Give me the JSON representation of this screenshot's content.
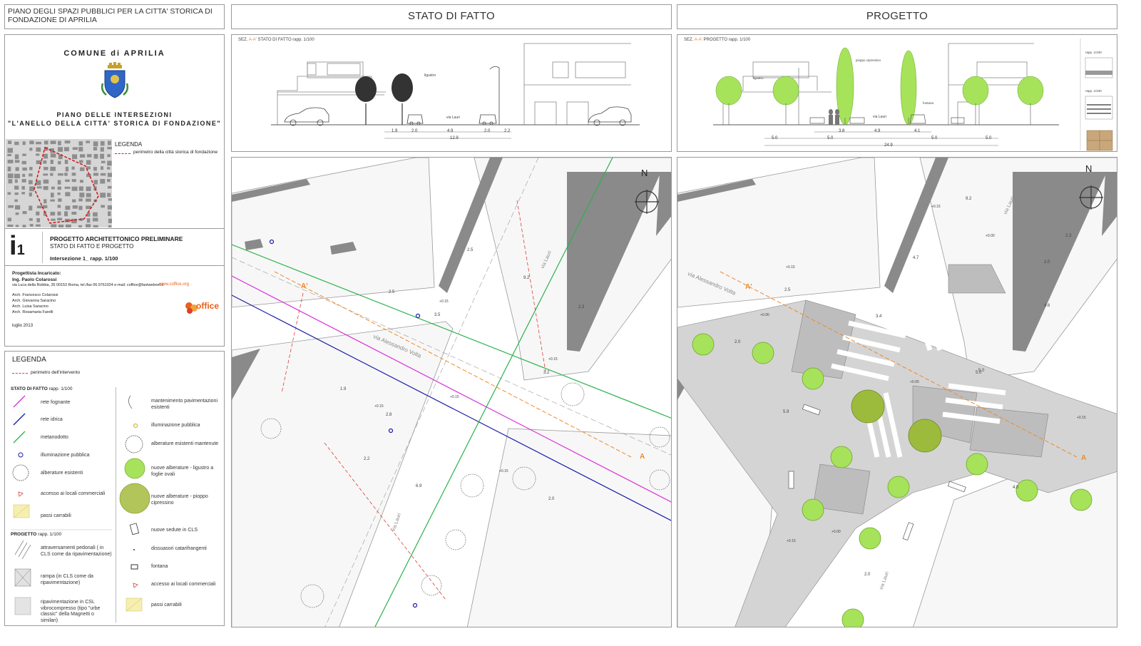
{
  "header": {
    "plan_title": "PIANO DEGLI SPAZI PUBBLICI PER LA CITTA' STORICA DI FONDAZIONE DI APRILIA",
    "stato": "STATO DI FATTO",
    "progetto": "PROGETTO"
  },
  "title_block": {
    "comune": "COMUNE di APRILIA",
    "piano1": "PIANO DELLE INTERSEZIONI",
    "piano2": "\"L'ANELLO DELLA CITTA' STORICA DI FONDAZIONE\"",
    "legenda": "LEGENDA",
    "legenda_item": "perimetro della città storica di fondazione",
    "code_letter": "i",
    "code_num": "1",
    "project_type": "PROGETTO ARCHITETTONICO PRELIMINARE",
    "project_sub": "STATO DI FATTO E PROGETTO",
    "intersection": "Intersezione 1_ rapp. 1/100",
    "progettista_label": "Progettista Incaricato:",
    "progettista": "Ing. Paolo Colarossi",
    "address": "via Luca della Robbia, 35 00153 Roma, tel./fax 06.9761024 e-mail: coffice@fastwebnet.it",
    "website": "www.coffice.org",
    "collaborators": [
      "Arch. Francesco Colarossi",
      "Arch. Giovanna Saracino",
      "Arch. Luisa Saracino",
      "Arch. Rosamaria Farelli"
    ],
    "date": "luglio 2013",
    "logo_text": "office"
  },
  "legend": {
    "title": "LEGENDA",
    "perimeter": "perimetro dell'intervento",
    "stato_title": "STATO DI FATTO",
    "stato_scale": "rapp. 1/100",
    "progetto_title": "PROGETTO",
    "progetto_scale": "rapp. 1/100",
    "left_items": [
      "rete fognante",
      "rete idrica",
      "metanodotto",
      "illuminazione pubblica",
      "alberature esistenti",
      "accesso ai locali commerciali",
      "passi carrabili"
    ],
    "progetto_items": [
      "attraversamenti pedonali ( in CLS come da ripavimentazione)",
      "rampa (in CLS come da ripavimentazione)",
      "ripavimentazione in CSL vibrocompresso (tipo \"urbe classic\" della Magnetti o similari)"
    ],
    "right_items": [
      "mantenimento pavimentazioni esistenti",
      "illuminazione pubblica",
      "alberature esistenti mantenute",
      "nuove alberature - ligustro a foglie ovali",
      "nuove alberature - pioppo cipressino",
      "nuove sedute in CLS",
      "dissuasori catarifrangenti",
      "fontana",
      "accesso ai locali commerciali",
      "passi carrabili"
    ]
  },
  "section_left": {
    "label_prefix": "SEZ.",
    "label_aa": "A-A'",
    "label_rest": "STATO DI FATTO rapp. 1/100",
    "tree_label": "ligustro",
    "street": "via Lauri",
    "dims": [
      "1.9",
      "2.0",
      "4.9",
      "2.0",
      "2.2"
    ],
    "total": "12.9"
  },
  "section_right": {
    "label_prefix": "SEZ.",
    "label_aa": "A-A'",
    "label_rest": "PROGETTO rapp. 1/100",
    "tree1": "ligustro",
    "tree2": "pioppo cipressino",
    "street": "via Lauri",
    "fontana": "fontana",
    "dims": [
      "3.8",
      "4.9",
      "4.1"
    ],
    "dims2": [
      "5.0",
      "5.0",
      "5.0",
      "5.0"
    ],
    "total": "24.9",
    "scale1": "rapp. 1/100",
    "scale2": "rapp. 1/100"
  },
  "map_left": {
    "north": "N",
    "street1": "via Alessandro Volta",
    "street2": "via Lauri",
    "street3": "via Lauri",
    "sec_a": "A",
    "sec_a2": "A'",
    "elev": [
      "+0.15",
      "+0.15",
      "+0.15",
      "+0.15",
      "+0.15"
    ],
    "dims": [
      "2.5",
      "9.2",
      "2.3",
      "3.5",
      "3.2",
      "2.5",
      "1.9",
      "2.8",
      "2.2",
      "6.9",
      "2.0"
    ]
  },
  "map_right": {
    "north": "N",
    "street1": "via Alessandro Volta",
    "street2": "via Lauri",
    "street3": "via Lauri",
    "sec_a": "A",
    "sec_a2": "A'",
    "elev": [
      "+0.15",
      "+0.00",
      "+0.00",
      "+0.15",
      "+0.00",
      "+0.00",
      "+0.15",
      "+0.15"
    ],
    "dims": [
      "9.2",
      "2.3",
      "4.7",
      "2.5",
      "3.4",
      "2.0",
      "4.6",
      "5.0",
      "5.9",
      "2.0",
      "4.0",
      "2.0",
      "5.0"
    ]
  },
  "colors": {
    "gas": "#2bb24c",
    "sewer": "#d930d9",
    "water": "#1a1aa8",
    "perimeter": "#e03a3a",
    "section": "#f08a2a",
    "tree_light": "#a6e35a",
    "tree_dark": "#9cbb3c"
  }
}
